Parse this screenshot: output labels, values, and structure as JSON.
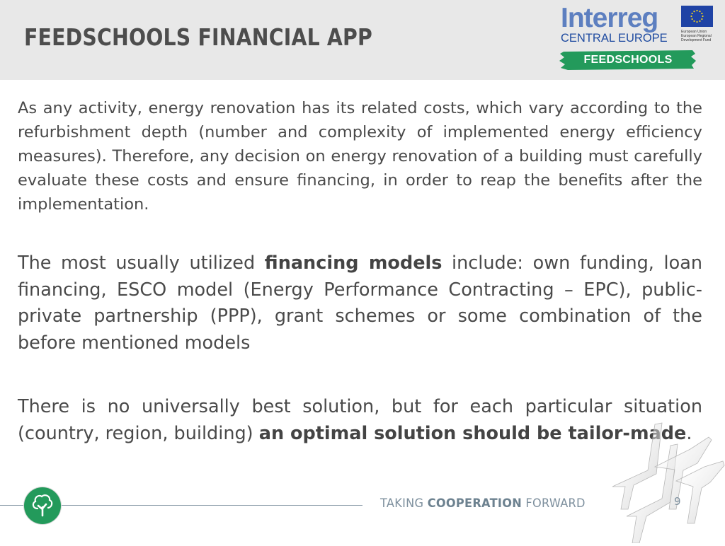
{
  "header": {
    "title": "FEEDSCHOOLS FINANCIAL APP"
  },
  "logo": {
    "program": "Interreg",
    "region": "CENTRAL EUROPE",
    "eu_lines": [
      "European Union",
      "European Regional",
      "Development Fund"
    ],
    "project": "FEEDSCHOOLS",
    "brand_color": "#5d7fc0",
    "banner_color": "#239a5b",
    "eu_flag_color": "#1f43a5"
  },
  "content": {
    "paragraph1": "As any activity, energy renovation has its related costs, which vary according to the refurbishment depth (number and complexity of implemented energy efficiency measures). Therefore, any decision on energy renovation of a building must carefully evaluate these costs and ensure financing, in order to reap the benefits after the implementation.",
    "paragraph2": {
      "before": "The most usually utilized ",
      "bold": "financing models",
      "after": " include: own funding, loan financing, ESCO model (Energy Performance Contracting – EPC), public-private partnership (PPP), grant schemes or some combination of the before mentioned models"
    },
    "paragraph3": {
      "before": "There is no universally best solution, but for each particular situation (country, region, building) ",
      "bold": "an optimal solution should be tailor-made",
      "after": "."
    }
  },
  "footer": {
    "tagline_prefix": "TAKING ",
    "tagline_bold": "COOPERATION",
    "tagline_suffix": " FORWARD",
    "page_number": "9",
    "icon": "tree-icon"
  }
}
